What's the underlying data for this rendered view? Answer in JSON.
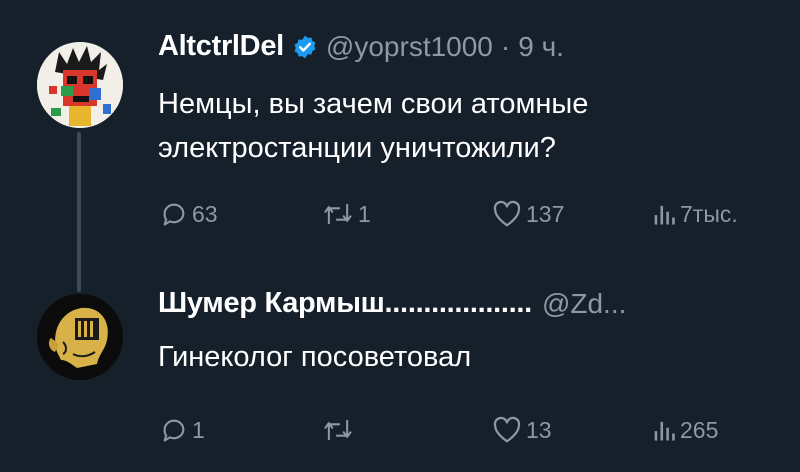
{
  "tweets": [
    {
      "name": "AltctrlDel",
      "handle": "@yoprst1000",
      "separator": "·",
      "time": "9 ч.",
      "text": "Немцы, вы зачем свои атомные\nэлектростанции уничтожили?",
      "actions": {
        "replies": "63",
        "retweets": "1",
        "likes": "137",
        "views": "7тыс."
      }
    },
    {
      "name": "Шумер Кармыш...................",
      "handle": "@Zd...",
      "text": "Гинеколог посоветовал",
      "actions": {
        "replies": "1",
        "retweets": "",
        "likes": "13",
        "views": "265"
      }
    }
  ],
  "colors": {
    "background": "#15202b",
    "secondary_text": "#8b98a5",
    "verified": "#1d9bf0",
    "thread_line": "#3d4b58"
  },
  "icons": [
    "reply-icon",
    "retweet-icon",
    "like-icon",
    "views-icon",
    "verified-icon"
  ]
}
